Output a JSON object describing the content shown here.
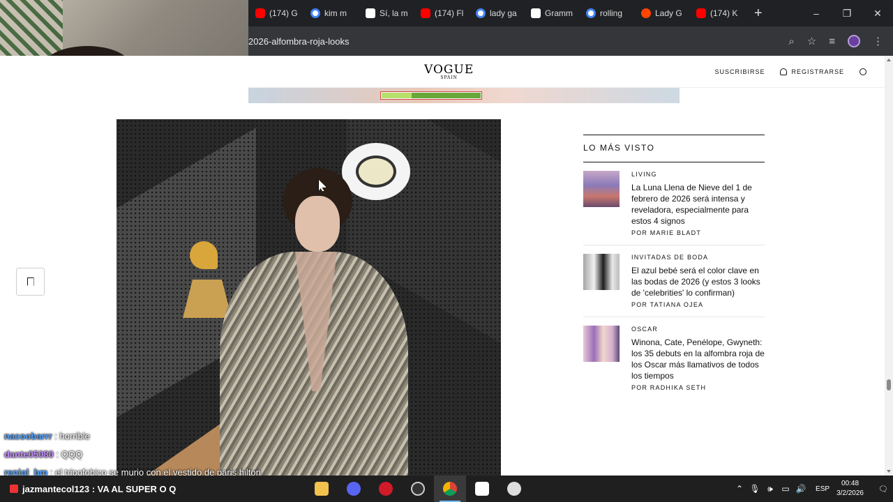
{
  "browser": {
    "tabs": [
      {
        "icon": "youtube-icon",
        "label": "(174) G"
      },
      {
        "icon": "google-icon",
        "label": "kim m"
      },
      {
        "icon": "vanity-fair-icon",
        "label": "Sí, la m"
      },
      {
        "icon": "youtube-icon",
        "label": "(174) Fl"
      },
      {
        "icon": "google-icon",
        "label": "lady ga"
      },
      {
        "icon": "grammys-icon",
        "label": "Gramm"
      },
      {
        "icon": "google-icon",
        "label": "rolling"
      },
      {
        "icon": "reddit-icon",
        "label": "Lady G"
      },
      {
        "icon": "youtube-icon",
        "label": "(174) K"
      }
    ],
    "new_tab": "+",
    "window_controls": {
      "minimize": "–",
      "restore": "❐",
      "close": "✕"
    },
    "url": "2026-alfombra-roja-looks"
  },
  "site": {
    "logo_name": "VOGUE",
    "logo_sub": "SPAIN",
    "subscribe": "SUSCRIBIRSE",
    "register": "REGISTRARSE"
  },
  "ad": {
    "progress": 0.3
  },
  "sidebar": {
    "heading": "LO MÁS VISTO",
    "articles": [
      {
        "category": "LIVING",
        "title": "La Luna Llena de Nieve del 1 de febrero de 2026 será intensa y reveladora, especialmente para estos 4 signos",
        "byline": "POR MARIE BLADT"
      },
      {
        "category": "INVITADAS DE BODA",
        "title": "El azul bebé será el color clave en las bodas de 2026 (y estos 3 looks de 'celebrities' lo confirman)",
        "byline": "POR TATIANA OJEA"
      },
      {
        "category": "OSCAR",
        "title": "Winona, Cate, Penélope, Gwyneth: los 35 debuts en la alfombra roja de los Oscar más llamativos de todos los tiempos",
        "byline": "POR RADHIKA SETH"
      }
    ]
  },
  "chat": [
    {
      "user": "nacoobarrr",
      "message": ": horrible"
    },
    {
      "user": "dante05080",
      "message": ": QQQ"
    },
    {
      "user": "reniol_bm",
      "message": ": el tripofobico se murio con el vestido de paris hilton"
    }
  ],
  "taskbar": {
    "pinned_chat": "jazmantecol123 : VA AL SUPER O Q",
    "lang": "ESP",
    "time": "00:48",
    "date": "3/2/2026"
  }
}
